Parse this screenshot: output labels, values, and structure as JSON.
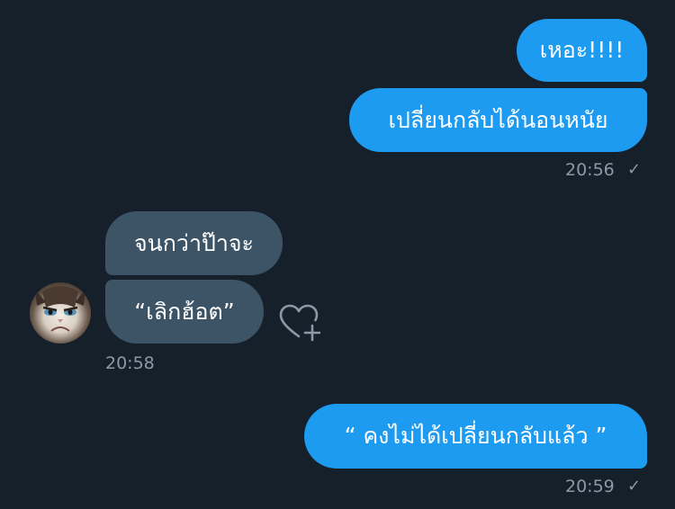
{
  "messages": [
    {
      "sender": "me",
      "text": "เหอะ!!!!"
    },
    {
      "sender": "me",
      "text": "เปลี่ยนกลับได้นอนหนัย"
    },
    {
      "sender": "other",
      "text": "จนกว่าป๊าจะ"
    },
    {
      "sender": "other",
      "text": "“เลิกฮ้อต”"
    },
    {
      "sender": "me",
      "text": "“ คงไม่ได้เปลี่ยนกลับแล้ว ”"
    }
  ],
  "timestamps": {
    "first_group": "20:56",
    "second_group": "20:58",
    "third_group": "20:59"
  },
  "read_mark": "✓",
  "icons": {
    "avatar": "grumpy-cat-avatar",
    "reaction": "heart-plus-icon"
  },
  "colors": {
    "background": "#15202b",
    "sent_bubble": "#1d9bf0",
    "received_bubble": "#3d5466",
    "meta_text": "#8b98a5"
  }
}
